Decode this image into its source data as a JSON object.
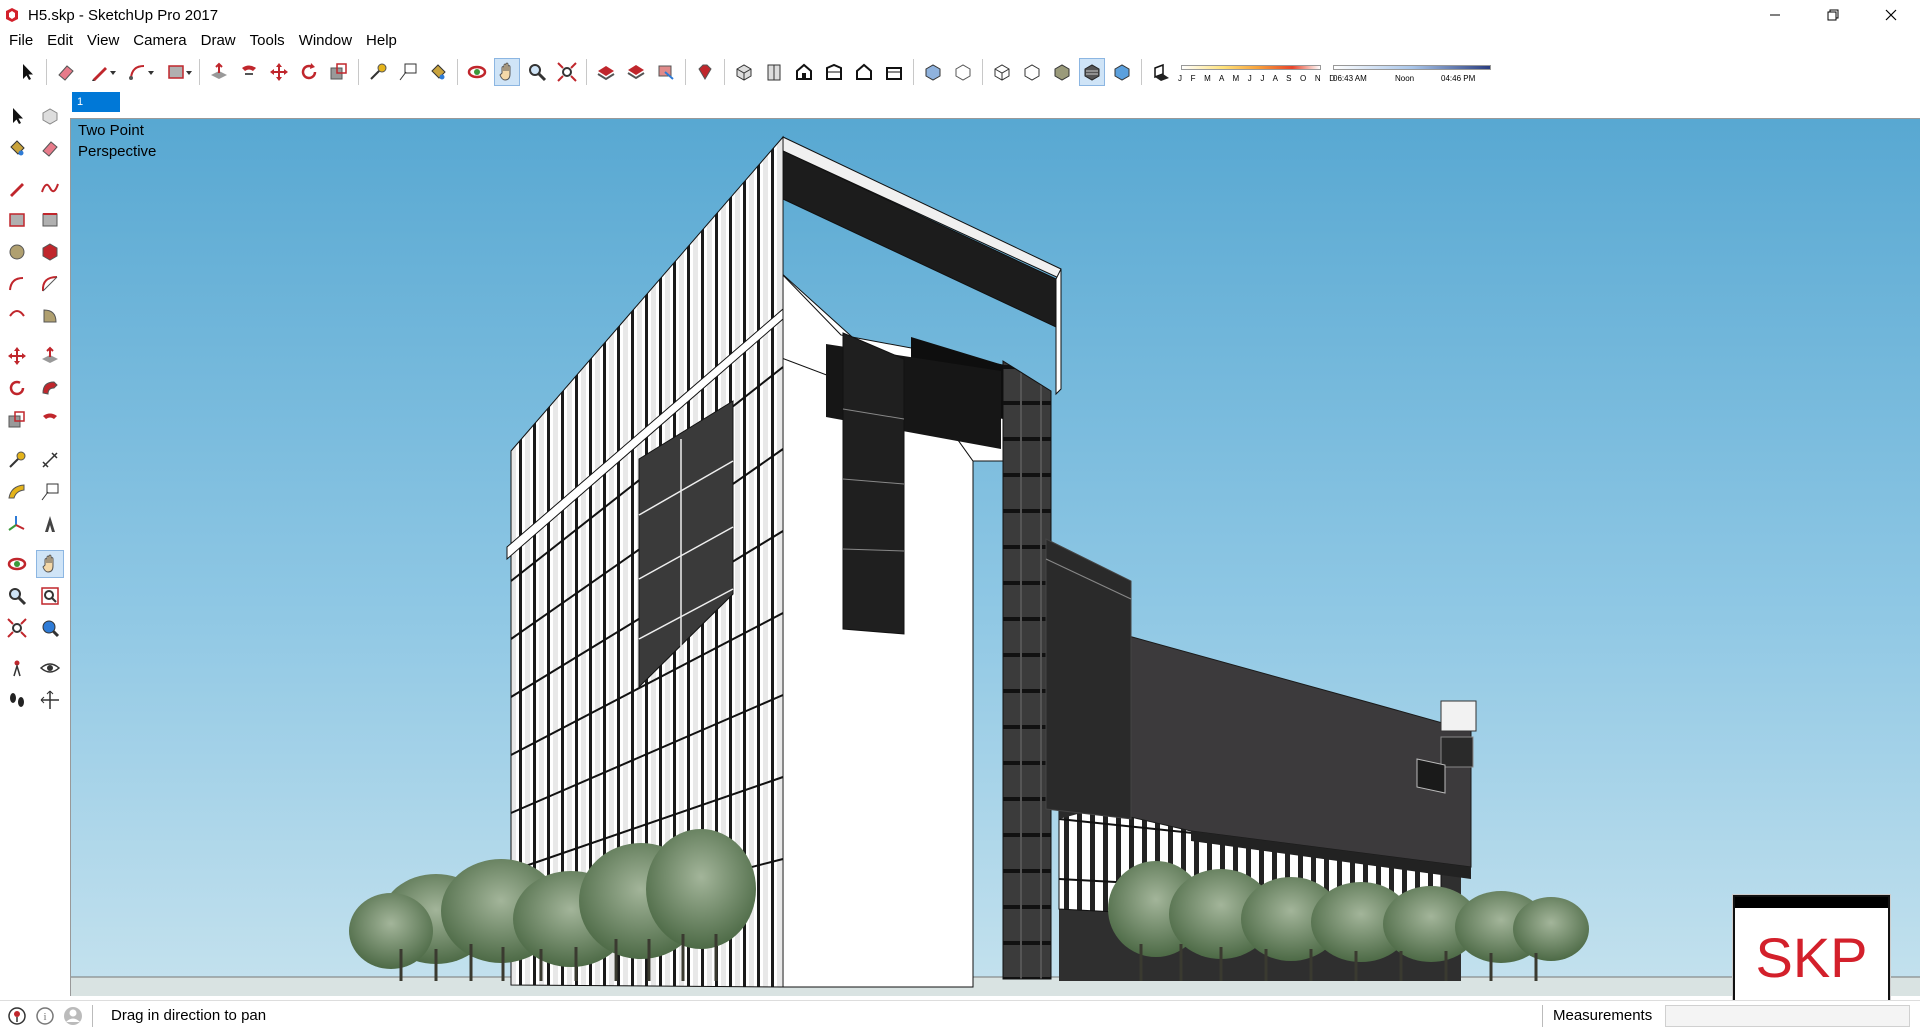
{
  "window": {
    "title": "H5.skp - SketchUp Pro 2017",
    "controls": [
      "minimize-icon",
      "restore-icon",
      "close-icon"
    ]
  },
  "menu": {
    "items": [
      "File",
      "Edit",
      "View",
      "Camera",
      "Draw",
      "Tools",
      "Window",
      "Help"
    ]
  },
  "toolbar": {
    "shadow_months_label": "J F M A M J J A S O N D",
    "shadow_time_start": "06:43 AM",
    "shadow_time_mid": "Noon",
    "shadow_time_end": "04:46 PM"
  },
  "scene_tabs": [
    "1"
  ],
  "viewport": {
    "camera_label_line1": "Two Point",
    "camera_label_line2": "Perspective"
  },
  "watermark": {
    "text": "SKP",
    "color": "#d3202b"
  },
  "statusbar": {
    "status_text": "Drag in direction to pan",
    "measurements_label": "Measurements",
    "measurements_value": ""
  },
  "colors": {
    "accent": "#0078d7",
    "sky_top": "#58a8d2",
    "sky_bottom": "#c5e2ee",
    "tool_red": "#c0262c"
  }
}
